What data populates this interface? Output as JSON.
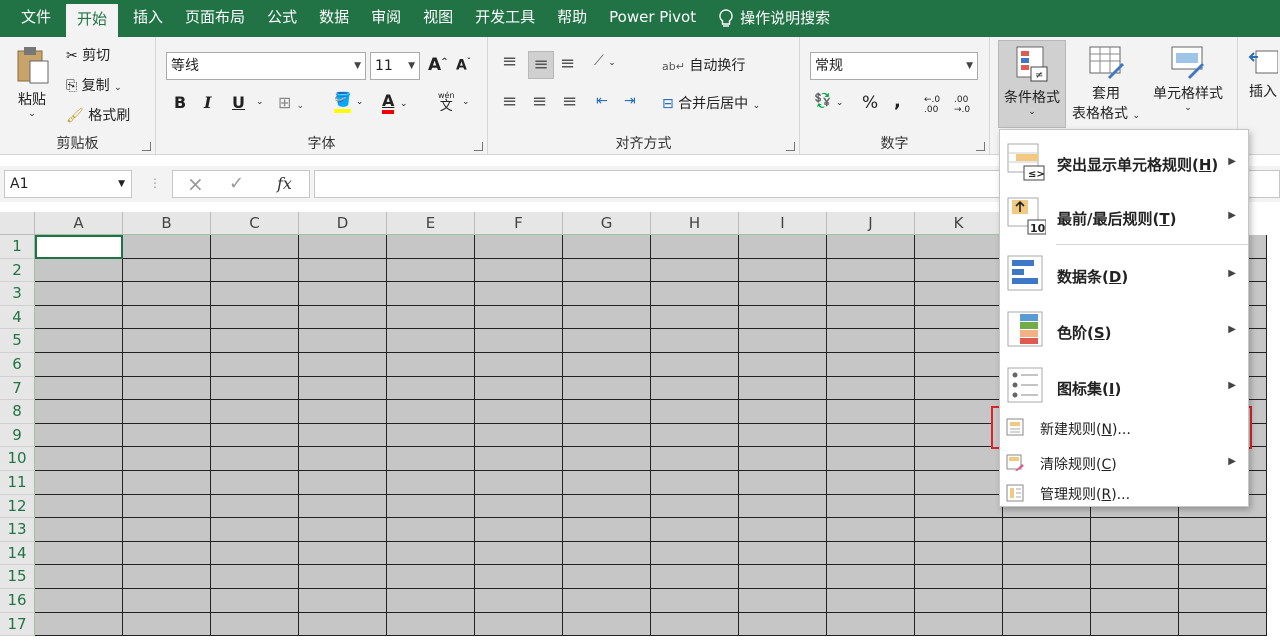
{
  "tabs": [
    {
      "label": "文件"
    },
    {
      "label": "开始"
    },
    {
      "label": "插入"
    },
    {
      "label": "页面布局"
    },
    {
      "label": "公式"
    },
    {
      "label": "数据"
    },
    {
      "label": "审阅"
    },
    {
      "label": "视图"
    },
    {
      "label": "开发工具"
    },
    {
      "label": "帮助"
    },
    {
      "label": "Power Pivot"
    },
    {
      "label": "操作说明搜索"
    }
  ],
  "clipboard": {
    "paste": "粘贴",
    "cut": "剪切",
    "copy": "复制",
    "format_painter": "格式刷",
    "group": "剪贴板"
  },
  "font": {
    "name": "等线",
    "size": "11",
    "bold": "B",
    "italic": "I",
    "underline": "U",
    "phonetic": "wén",
    "phonetic_char": "文",
    "group": "字体",
    "grow": "A",
    "shrink": "A",
    "font_color_letter": "A"
  },
  "alignment": {
    "wrap": "自动换行",
    "merge": "合并后居中",
    "group": "对齐方式"
  },
  "number": {
    "format": "常规",
    "percent": "%",
    "comma": ",",
    "inc_decimal": "←.0 .00",
    "dec_decimal": ".00 →.0",
    "group": "数字"
  },
  "styles": {
    "conditional": "条件格式",
    "table_format_1": "套用",
    "table_format_2": "表格格式",
    "cell_styles": "单元格样式",
    "insert": "插入"
  },
  "formula_bar": {
    "name_box": "A1",
    "fx": "fx",
    "cancel": "×",
    "enter": "✓"
  },
  "columns": [
    "A",
    "B",
    "C",
    "D",
    "E",
    "F",
    "G",
    "H",
    "I",
    "J",
    "K"
  ],
  "rows": [
    "1",
    "2",
    "3",
    "4",
    "5",
    "6",
    "7",
    "8",
    "9",
    "10",
    "11",
    "12",
    "13",
    "14",
    "15",
    "16",
    "17"
  ],
  "menu": {
    "items": [
      {
        "label": "突出显示单元格规则(",
        "key": "H",
        "end": ")"
      },
      {
        "label": "最前/最后规则(",
        "key": "T",
        "end": ")"
      },
      {
        "label": "数据条(",
        "key": "D",
        "end": ")"
      },
      {
        "label": "色阶(",
        "key": "S",
        "end": ")"
      },
      {
        "label": "图标集(",
        "key": "I",
        "end": ")"
      }
    ],
    "small": [
      {
        "label": "新建规则(",
        "key": "N",
        "end": ")..."
      },
      {
        "label": "清除规则(",
        "key": "C",
        "end": ")"
      },
      {
        "label": "管理规则(",
        "key": "R",
        "end": ")..."
      }
    ],
    "icon_10": "10"
  },
  "colors": {
    "accent": "#217346",
    "highlight_border": "#d9252b",
    "cell_fill": "#c6c6c6"
  }
}
